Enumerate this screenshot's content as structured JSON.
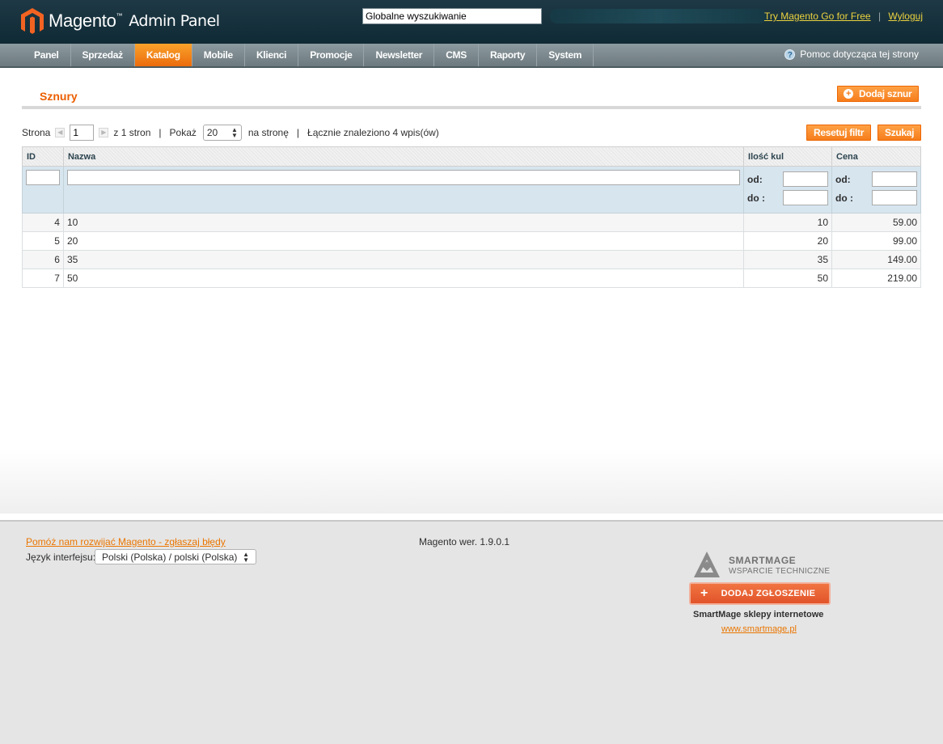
{
  "header": {
    "brand": "Magento",
    "brand_tm": "™",
    "brand_sub": "Admin Panel",
    "search_value": "Globalne wyszukiwanie",
    "try_link": "Try Magento Go for Free",
    "logout_link": "Wyloguj",
    "separator": "|"
  },
  "nav": {
    "items": [
      "Panel",
      "Sprzedaż",
      "Katalog",
      "Mobile",
      "Klienci",
      "Promocje",
      "Newsletter",
      "CMS",
      "Raporty",
      "System"
    ],
    "active": "Katalog",
    "help": "Pomoc dotycząca tej strony",
    "help_icon": "?"
  },
  "page": {
    "title": "Sznury",
    "add_button": "Dodaj sznur",
    "reset_button": "Resetuj filtr",
    "search_button": "Szukaj"
  },
  "pager": {
    "page_label": "Strona",
    "page_value": "1",
    "of_pages": "z 1 stron",
    "show_label": "Pokaż",
    "limit": "20",
    "per_page": "na stronę",
    "total": "Łącznie znaleziono 4 wpis(ów)",
    "sep": "|"
  },
  "grid": {
    "columns": [
      "ID",
      "Nazwa",
      "Ilość kul",
      "Cena"
    ],
    "range_from": "od:",
    "range_to": "do :",
    "rows": [
      {
        "id": "4",
        "name": "10",
        "qty": "10",
        "price": "59.00"
      },
      {
        "id": "5",
        "name": "20",
        "qty": "20",
        "price": "99.00"
      },
      {
        "id": "6",
        "name": "35",
        "qty": "35",
        "price": "149.00"
      },
      {
        "id": "7",
        "name": "50",
        "qty": "50",
        "price": "219.00"
      }
    ]
  },
  "footer": {
    "bug_link": "Pomóż nam rozwijać Magento - zgłaszaj błędy",
    "lang_label": "Język interfejsu:",
    "lang_value": "Polski (Polska) / polski (Polska)",
    "version": "Magento wer. 1.9.0.1",
    "sm_name": "SMARTMAGE",
    "sm_sub": "WSPARCIE TECHNICZNE",
    "sm_button": "DODAJ ZGŁOSZENIE",
    "sm_tag": "SmartMage sklepy internetowe",
    "sm_link": "www.smartmage.pl"
  },
  "colors": {
    "accent": "#eb5e00",
    "header_bg": "#1e3945",
    "nav_bg": "#7c898f",
    "filter_bg": "#d7e5ef"
  }
}
